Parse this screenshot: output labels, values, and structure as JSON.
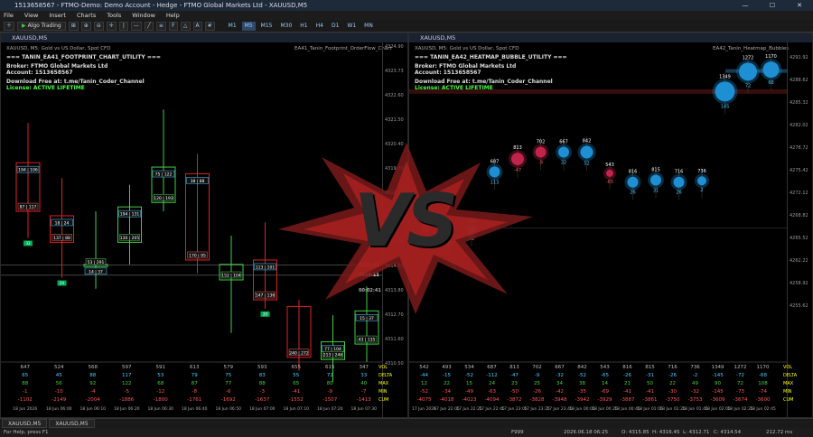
{
  "window": {
    "title": "1513658567 - FTMO-Demo: Demo Account - Hedge - FTMO Global Markets Ltd - XAUUSD,M5",
    "min": "—",
    "max": "☐",
    "close": "✕"
  },
  "menu": [
    "File",
    "View",
    "Insert",
    "Charts",
    "Tools",
    "Window",
    "Help"
  ],
  "toolbar": {
    "algo": "Algo Trading",
    "timeframes": [
      "M1",
      "M5",
      "M15",
      "M30",
      "H1",
      "H4",
      "D1",
      "W1",
      "MN"
    ],
    "selected": "M5"
  },
  "left": {
    "tab": "XAUUSD,M5",
    "symbol": "XAUUSD, M5:  Gold vs US Dollar, Spot CFD",
    "ea": "EA41_Tanin_Footprint_OrderFlow_Chart",
    "info": [
      "=== TANIN_EA41_FOOTPRINT_CHART_UTILITY ===",
      "Broker: FTMO Global Markets Ltd",
      "Account: 1513658567",
      "Download Free at: t.me/Tanin_Coder_Channel",
      "License: ACTIVE LIFETIME"
    ],
    "prices": [
      "4324.90",
      "4323.73",
      "4322.60",
      "4321.50",
      "4320.40",
      "4319.30",
      "4318.20",
      "4317.10",
      "4316.00",
      "4314.90",
      "4313.80",
      "4312.70",
      "4311.60",
      "4310.50"
    ],
    "cur1": "4315.57",
    "cur2": "4315.11",
    "timer": "00:02:41",
    "cols": [
      "647",
      "524",
      "568",
      "597",
      "591",
      "613",
      "579",
      "593",
      "655",
      "615",
      "347"
    ],
    "delta": [
      "65",
      "45",
      "88",
      "117",
      "53",
      "79",
      "75",
      "83",
      "55",
      "72",
      "33"
    ],
    "max": [
      "88",
      "56",
      "92",
      "122",
      "68",
      "87",
      "77",
      "88",
      "65",
      "80",
      "40"
    ],
    "min": [
      "-1",
      "-10",
      "-4",
      "-5",
      "-12",
      "-8",
      "-6",
      "-3",
      "-41",
      "-9",
      "-7"
    ],
    "cum": [
      "-1102",
      "-2149",
      "-2004",
      "-1886",
      "-1800",
      "-1761",
      "-1692",
      "-1637",
      "-1552",
      "-1507",
      "-1413"
    ],
    "rowlabels": [
      "VOL",
      "DELTA",
      "MAX",
      "MIN",
      "CUM"
    ],
    "dates": [
      "18 Jun 2026",
      "18 Jun 06:00",
      "18 Jun 06:10",
      "18 Jun 06:20",
      "18 Jun 06:30",
      "18 Jun 06:40",
      "18 Jun 06:50",
      "18 Jun 07:00",
      "18 Jun 07:10",
      "18 Jun 07:20",
      "18 Jun 07:30"
    ],
    "candles": [
      {
        "o": 4320.2,
        "c": 4318.0,
        "h": 4322.0,
        "l": 4316.8,
        "bull": false,
        "top": "194 | 106",
        "bot": "87 | 117",
        "bx": "33"
      },
      {
        "o": 4317.8,
        "c": 4316.6,
        "h": 4319.5,
        "l": 4315.0,
        "bull": false,
        "top": "18 | 24",
        "bot": "137 | 88",
        "bx": "24"
      },
      {
        "o": 4315.6,
        "c": 4315.5,
        "h": 4318.0,
        "l": 4314.5,
        "bull": true,
        "top": "14 | 37",
        "bot": "53 | 291",
        "bx": ""
      },
      {
        "o": 4316.6,
        "c": 4318.2,
        "h": 4319.2,
        "l": 4315.6,
        "bull": true,
        "top": "194 | 131",
        "bot": "130 | 205",
        "bx": ""
      },
      {
        "o": 4318.4,
        "c": 4320.0,
        "h": 4322.6,
        "l": 4318.0,
        "bull": true,
        "top": "75 | 122",
        "bot": "120 | 193",
        "bx": ""
      },
      {
        "o": 4319.7,
        "c": 4315.8,
        "h": 4320.6,
        "l": 4315.2,
        "bull": false,
        "top": "38 | 88",
        "bot": "170 | 95",
        "bx": ""
      },
      {
        "o": 4315.6,
        "c": 4314.9,
        "h": 4316.9,
        "l": 4312.5,
        "bull": true,
        "top": "",
        "bot": "152 | 104",
        "bx": ""
      },
      {
        "o": 4315.8,
        "c": 4314.0,
        "h": 4317.5,
        "l": 4313.6,
        "bull": false,
        "top": "113 | 101",
        "bot": "147 | 136",
        "bx": "20"
      },
      {
        "o": 4313.7,
        "c": 4311.4,
        "h": 4314.0,
        "l": 4310.8,
        "bull": false,
        "top": "",
        "bot": "240 | 272",
        "bx": ""
      },
      {
        "o": 4312.1,
        "c": 4311.3,
        "h": 4313.3,
        "l": 4310.3,
        "bull": true,
        "top": "77 | 104",
        "bot": "213 | 246",
        "bx": ""
      },
      {
        "o": 4312.0,
        "c": 4313.5,
        "h": 4314.6,
        "l": 4311.2,
        "bull": true,
        "top": "15 | 37",
        "bot": "43 | 135",
        "bx": ""
      }
    ]
  },
  "right": {
    "tab": "XAUUSD,M5",
    "symbol": "XAUUSD, M5:  Gold vs US Dollar, Spot CFD",
    "ea": "EA42_Tanin_Heatmap_Bubbles",
    "info": [
      "=== TANIN_EA42_HEATMAP_BUBBLE_UTILITY ===",
      "Broker: FTMO Global Markets Ltd",
      "Account: 1513658567",
      "Download Free at: t.me/Tanin_Coder_Channel",
      "License: ACTIVE LIFETIME"
    ],
    "prices": [
      "4291.92",
      "4288.62",
      "4285.32",
      "4282.02",
      "4278.72",
      "4275.42",
      "4272.12",
      "4268.82",
      "4265.52",
      "4262.22",
      "4258.92",
      "4255.62"
    ],
    "cols": [
      "542",
      "493",
      "534",
      "687",
      "813",
      "702",
      "667",
      "842",
      "543",
      "816",
      "815",
      "716",
      "736",
      "1349",
      "1272",
      "1170"
    ],
    "delta": [
      "-44",
      "-15",
      "-52",
      "-112",
      "-47",
      "-9",
      "-32",
      "-52",
      "-65",
      "-26",
      "-31",
      "-26",
      "-2",
      "-145",
      "-72",
      "-68"
    ],
    "max": [
      "12",
      "22",
      "15",
      "24",
      "23",
      "25",
      "34",
      "38",
      "14",
      "21",
      "50",
      "22",
      "49",
      "90",
      "72",
      "108"
    ],
    "min": [
      "-52",
      "-34",
      "-49",
      "-63",
      "-50",
      "-26",
      "-42",
      "-35",
      "-69",
      "-41",
      "-41",
      "-30",
      "-32",
      "-145",
      "-73",
      "-74"
    ],
    "cum": [
      "-4075",
      "-4018",
      "-4023",
      "-4094",
      "-3872",
      "-3828",
      "-3948",
      "-3942",
      "-3929",
      "-3887",
      "-3861",
      "-3750",
      "-3753",
      "-3609",
      "-3674",
      "-3600"
    ],
    "rowlabels": [
      "VOL",
      "DELTA",
      "MAX",
      "MIN",
      "CUM"
    ],
    "dates": [
      "17 Jun 2026",
      "17 Jun 22:05",
      "17 Jun 22:25",
      "17 Jun 22:45",
      "17 Jun 23:05",
      "17 Jun 23:25",
      "17 Jun 23:45",
      "18 Jun 00:05",
      "18 Jun 00:25",
      "18 Jun 00:45",
      "18 Jun 01:05",
      "18 Jun 01:25",
      "18 Jun 01:45",
      "18 Jun 02:05",
      "18 Jun 02:25",
      "18 Jun 02:45"
    ],
    "bubbles": [
      {
        "v": "542",
        "d": "-44",
        "y": 4266.5,
        "r": 5,
        "neg": true
      },
      {
        "v": "493",
        "d": "15",
        "y": 4264.5,
        "r": 4,
        "neg": false
      },
      {
        "v": "534",
        "d": "52",
        "y": 4266.2,
        "r": 4,
        "neg": false
      },
      {
        "v": "687",
        "d": "113",
        "y": 4274.7,
        "r": 6,
        "neg": false
      },
      {
        "v": "813",
        "d": "-47",
        "y": 4276.6,
        "r": 7,
        "neg": true
      },
      {
        "v": "702",
        "d": "-9",
        "y": 4277.6,
        "r": 6,
        "neg": true
      },
      {
        "v": "667",
        "d": "32",
        "y": 4277.6,
        "r": 6,
        "neg": false
      },
      {
        "v": "842",
        "d": "52",
        "y": 4277.6,
        "r": 7,
        "neg": false
      },
      {
        "v": "543",
        "d": "-65",
        "y": 4274.5,
        "r": 4,
        "neg": true
      },
      {
        "v": "816",
        "d": "26",
        "y": 4273.2,
        "r": 6,
        "neg": false
      },
      {
        "v": "815",
        "d": "31",
        "y": 4273.5,
        "r": 6,
        "neg": false
      },
      {
        "v": "716",
        "d": "26",
        "y": 4273.2,
        "r": 6,
        "neg": false
      },
      {
        "v": "736",
        "d": "2",
        "y": 4273.4,
        "r": 5,
        "neg": false
      },
      {
        "v": "1349",
        "d": "145",
        "y": 4286.5,
        "r": 11,
        "neg": false
      },
      {
        "v": "1272",
        "d": "72",
        "y": 4289.4,
        "r": 10,
        "neg": false
      },
      {
        "v": "1170",
        "d": "68",
        "y": 4289.7,
        "r": 9,
        "neg": false
      }
    ]
  },
  "center": {
    "logo": "VS"
  },
  "tabs": [
    "XAUUSD,M5",
    "XAUUSD,M5"
  ],
  "status": {
    "help": "For Help, press F1",
    "profile": "F999",
    "datetime": "2026.06.18 06:25",
    "open": "O: 4315.85",
    "high": "H: 4316.45",
    "low": "L: 4312.71",
    "close": "C: 4314.54",
    "kb": "212.72 ms"
  }
}
